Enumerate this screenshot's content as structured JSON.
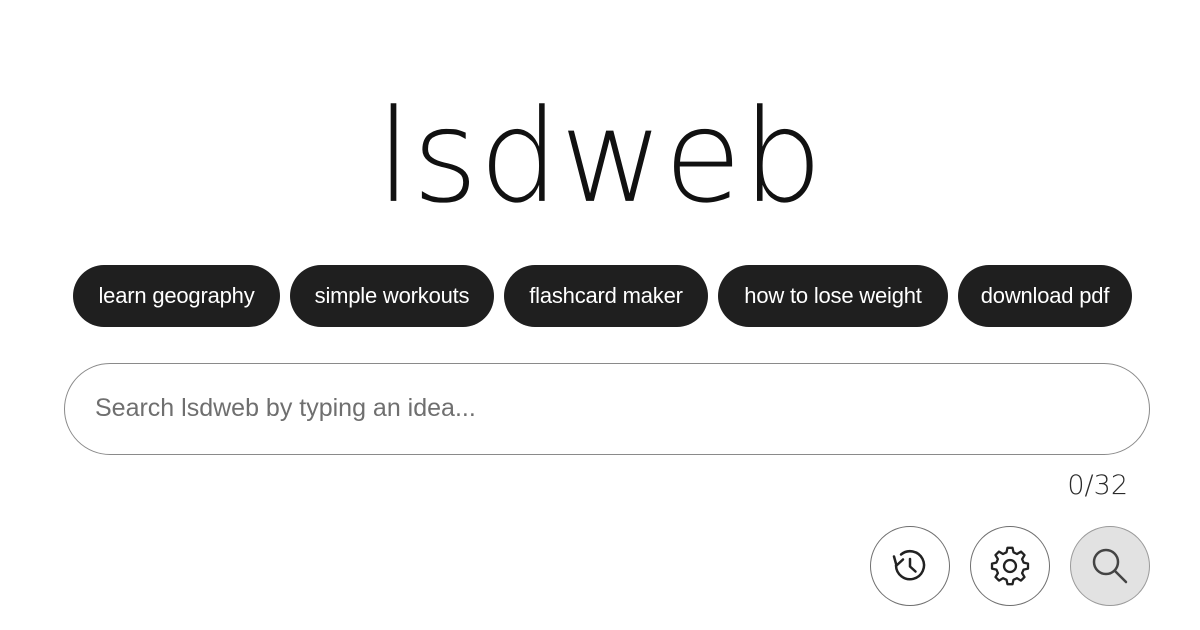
{
  "logo": {
    "text": "lsdweb"
  },
  "suggestions": [
    {
      "label": "learn geography"
    },
    {
      "label": "simple workouts"
    },
    {
      "label": "flashcard maker"
    },
    {
      "label": "how to lose weight"
    },
    {
      "label": "download pdf"
    }
  ],
  "search": {
    "value": "",
    "placeholder": "Search lsdweb by typing an idea...",
    "counter": "0/32"
  },
  "actions": {
    "history_icon": "history-icon",
    "settings_icon": "gear-icon",
    "search_icon": "search-icon"
  },
  "colors": {
    "chip_background": "#1f1f1f",
    "chip_text": "#ffffff",
    "search_button_background": "#e2e2e2"
  }
}
